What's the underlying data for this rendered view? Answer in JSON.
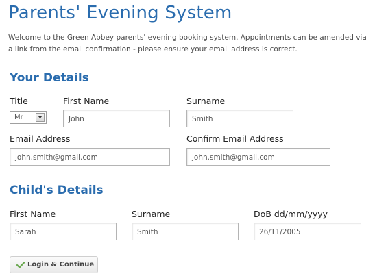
{
  "page": {
    "title": "Parents' Evening System",
    "intro": "Welcome to the Green Abbey parents' evening booking system. Appointments can be amended via a link from the email confirmation - please ensure your email address is correct."
  },
  "your_details": {
    "heading": "Your Details",
    "title_label": "Title",
    "title_value": "Mr",
    "first_name_label": "First Name",
    "first_name_value": "John",
    "surname_label": "Surname",
    "surname_value": "Smith",
    "email_label": "Email Address",
    "email_value": "john.smith@gmail.com",
    "confirm_email_label": "Confirm Email Address",
    "confirm_email_value": "john.smith@gmail.com"
  },
  "child_details": {
    "heading": "Child's Details",
    "first_name_label": "First Name",
    "first_name_value": "Sarah",
    "surname_label": "Surname",
    "surname_value": "Smith",
    "dob_label": "DoB dd/mm/yyyy",
    "dob_value": "26/11/2005"
  },
  "actions": {
    "login_label": "Login & Continue",
    "login_icon": "check-icon"
  },
  "colors": {
    "heading": "#2a6cae",
    "check": "#6aa84f"
  }
}
